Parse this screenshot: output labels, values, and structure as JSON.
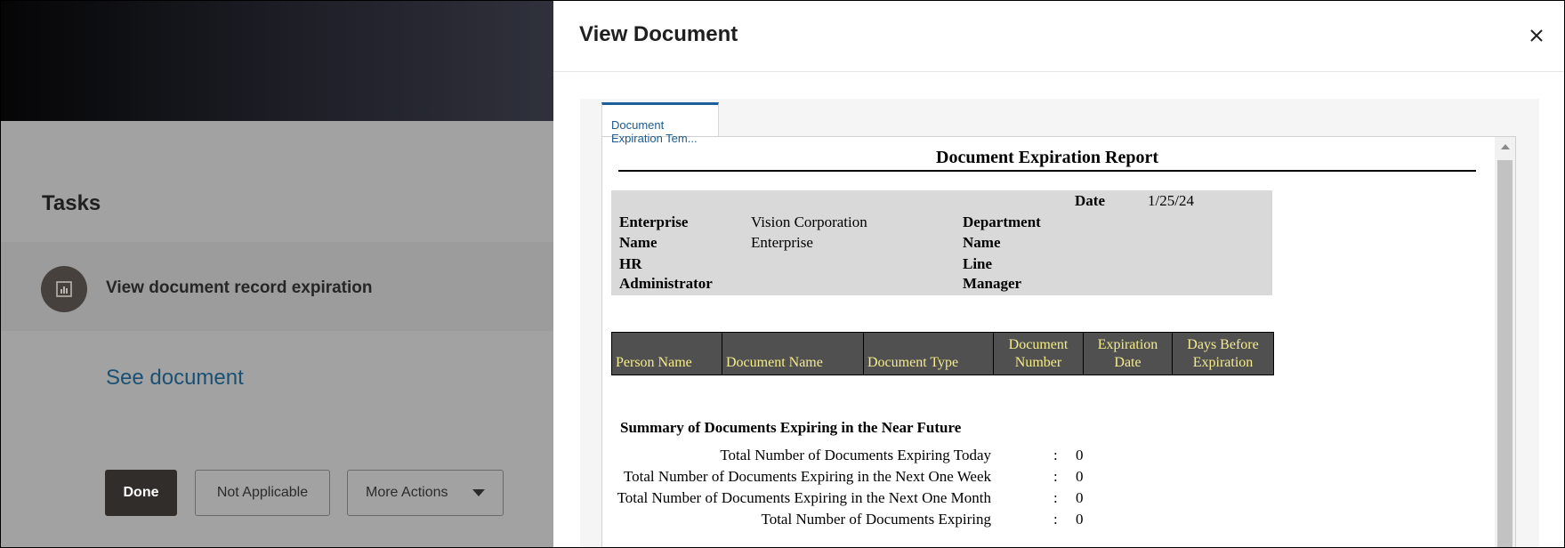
{
  "background": {
    "tasks_title": "Tasks",
    "task_label": "View document record expiration",
    "see_document_link": "See document",
    "buttons": {
      "done": "Done",
      "not_applicable": "Not Applicable",
      "more_actions": "More Actions"
    }
  },
  "drawer": {
    "title": "View Document",
    "tab_label": "Document Expiration Tem..."
  },
  "report": {
    "title": "Document Expiration Report",
    "info": {
      "date_label": "Date",
      "date_value": "1/25/24",
      "enterprise_label_1": "Enterprise",
      "enterprise_label_2": "Name",
      "enterprise_value_1": "Vision Corporation",
      "enterprise_value_2": "Enterprise",
      "department_label_1": "Department",
      "department_label_2": "Name",
      "hr_label_1": "HR",
      "hr_label_2": "Administrator",
      "line_label_1": "Line",
      "line_label_2": "Manager"
    },
    "columns": [
      {
        "line1": "",
        "line2": "Person Name"
      },
      {
        "line1": "",
        "line2": "Document Name"
      },
      {
        "line1": "",
        "line2": "Document Type"
      },
      {
        "line1": "Document",
        "line2": "Number"
      },
      {
        "line1": "Expiration",
        "line2": "Date"
      },
      {
        "line1": "Days Before",
        "line2": "Expiration"
      }
    ],
    "summary_title": "Summary of Documents Expiring in the Near Future",
    "summary": [
      {
        "label": "Total Number of Documents Expiring Today",
        "value": "0"
      },
      {
        "label": "Total Number of Documents Expiring in the Next One Week",
        "value": "0"
      },
      {
        "label": "Total Number of Documents Expiring in the Next One Month",
        "value": "0"
      },
      {
        "label": "Total Number of Documents Expiring",
        "value": "0"
      }
    ],
    "colon": ":"
  },
  "colors": {
    "accent": "#1e5e9a",
    "header_text": "#f5ec8c",
    "header_bg": "#505050",
    "info_bg": "#d9d9d9"
  }
}
